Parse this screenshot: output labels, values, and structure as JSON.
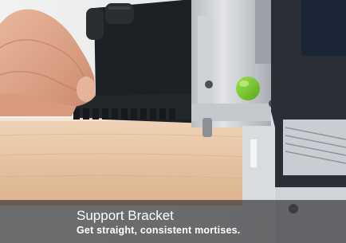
{
  "caption": {
    "title": "Support Bracket",
    "subtitle": "Get straight, consistent mortises."
  }
}
